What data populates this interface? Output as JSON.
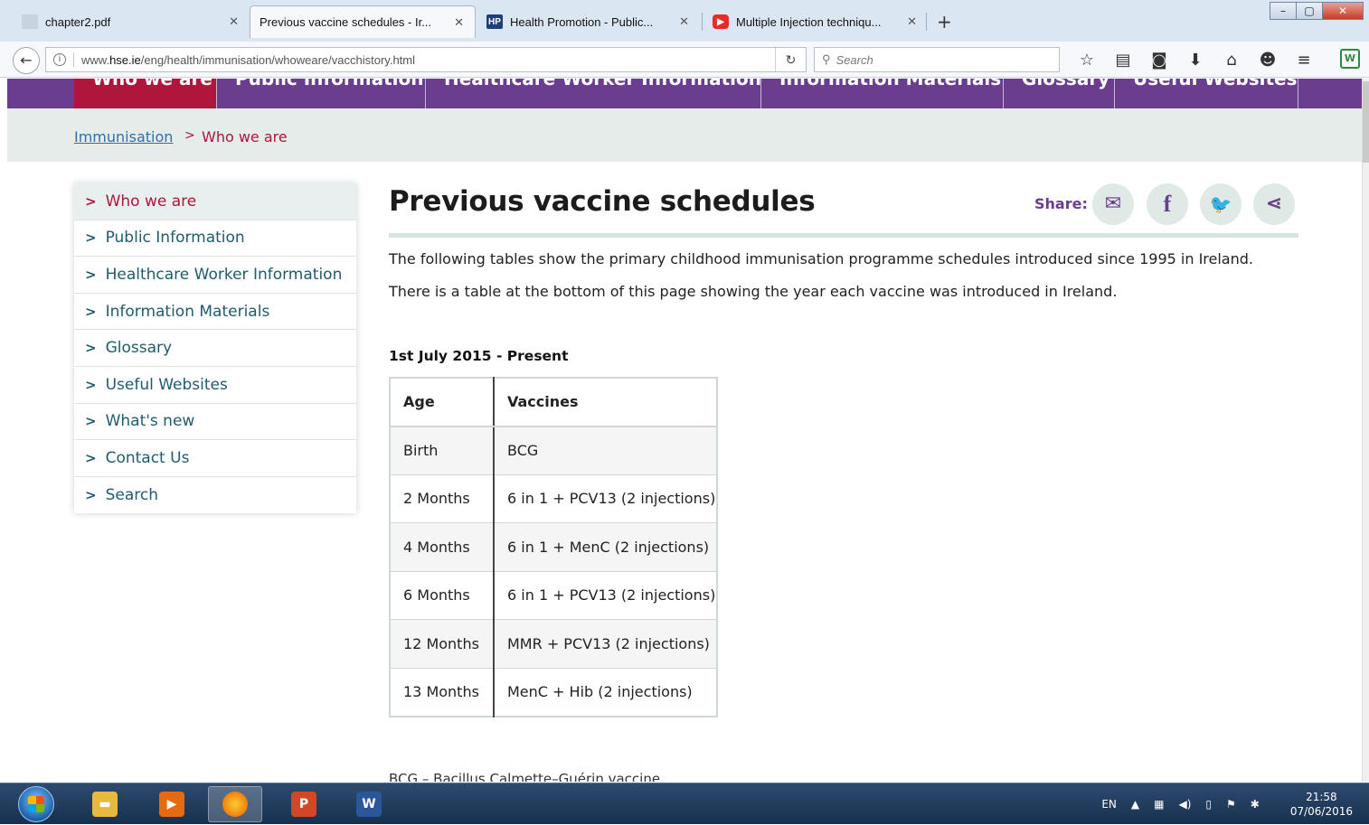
{
  "browser": {
    "tabs": [
      {
        "title": "chapter2.pdf"
      },
      {
        "title": "Previous vaccine schedules - Ir..."
      },
      {
        "title": "Health Promotion - Public...",
        "icon": "HP"
      },
      {
        "title": "Multiple Injection techniqu..."
      }
    ],
    "url_prefix": "www.",
    "url_host": "hse.ie",
    "url_path": "/eng/health/immunisation/whoweare/vacchistory.html",
    "search_placeholder": "Search"
  },
  "site": {
    "topnav": [
      "Who we are",
      "Public Information",
      "Healthcare Worker Information",
      "Information Materials",
      "Glossary",
      "Useful Websites"
    ],
    "breadcrumb": {
      "root": "Immunisation",
      "separator": ">",
      "current": "Who we are"
    },
    "sidenav": [
      "Who we are",
      "Public Information",
      "Healthcare Worker Information",
      "Information Materials",
      "Glossary",
      "Useful Websites",
      "What's new",
      "Contact Us",
      "Search"
    ],
    "accent": "#b0153c",
    "brand": "#6a3d8f"
  },
  "page": {
    "title": "Previous vaccine schedules",
    "share_label": "Share:",
    "share_icons": [
      "email-icon",
      "facebook-icon",
      "twitter-icon",
      "share-icon"
    ],
    "intro1": "The following tables show the primary childhood immunisation programme schedules introduced since 1995 in Ireland.",
    "intro2": "There is a table at the bottom of this page showing the year each vaccine was introduced in Ireland.",
    "section_heading": "1st July 2015 - Present",
    "table": {
      "headers": [
        "Age",
        "Vaccines"
      ],
      "rows": [
        [
          "Birth",
          "BCG"
        ],
        [
          "2 Months",
          "6 in 1 + PCV13 (2 injections)"
        ],
        [
          "4 Months",
          "6 in 1 + MenC (2 injections)"
        ],
        [
          "6 Months",
          "6 in 1 + PCV13 (2 injections)"
        ],
        [
          "12 Months",
          "MMR + PCV13 (2 injections)"
        ],
        [
          "13 Months",
          "MenC + Hib (2 injections)"
        ]
      ]
    },
    "footnote": "BCG – Bacillus Calmette–Guérin vaccine"
  },
  "taskbar": {
    "language": "EN",
    "time": "21:58",
    "date": "07/06/2016"
  }
}
